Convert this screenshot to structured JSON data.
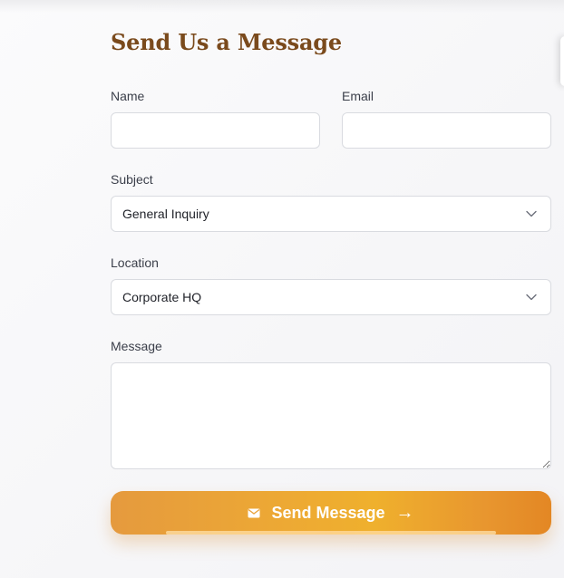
{
  "form": {
    "title": "Send Us a Message",
    "name": {
      "label": "Name",
      "value": "",
      "placeholder": ""
    },
    "email": {
      "label": "Email",
      "value": "",
      "placeholder": ""
    },
    "subject": {
      "label": "Subject",
      "value": "General Inquiry",
      "icon": "chevron-down-icon"
    },
    "location": {
      "label": "Location",
      "value": "Corporate HQ",
      "icon": "chevron-down-icon"
    },
    "message": {
      "label": "Message",
      "value": "",
      "placeholder": ""
    },
    "submit": {
      "label": "Send Message",
      "icon": "mail-icon",
      "trailing_icon": "arrow-right-icon",
      "arrow_glyph": "→"
    }
  },
  "colors": {
    "title": "#7a4a1c",
    "button_gradient_start": "#e59a3e",
    "button_gradient_mid": "#efb02d",
    "button_gradient_end": "#e38724"
  }
}
